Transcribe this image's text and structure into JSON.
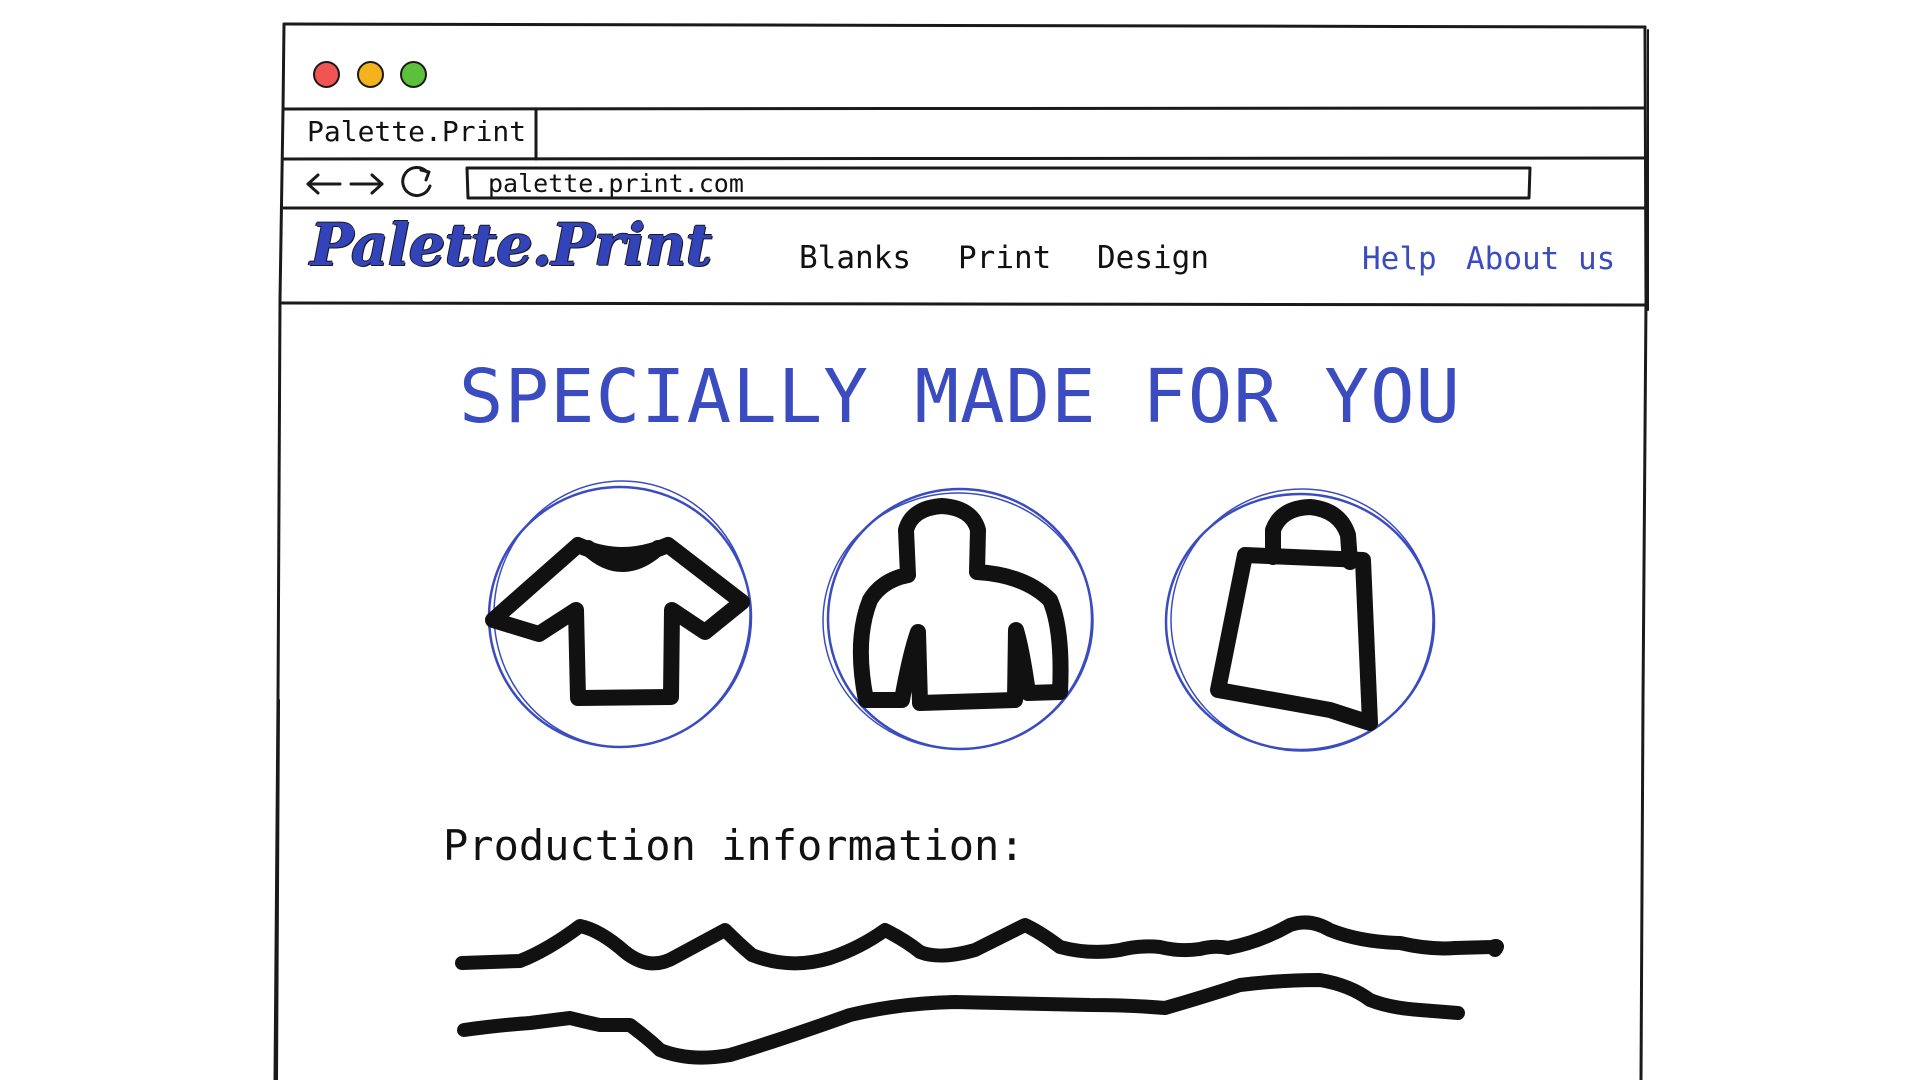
{
  "browser": {
    "tab_title": "Palette.Print",
    "url": "palette.print.com",
    "traffic_lights": {
      "close_color": "#f05454",
      "minimize_color": "#f4b31c",
      "maximize_color": "#5cc13a"
    },
    "nav_icons": [
      "back-arrow-icon",
      "forward-arrow-icon",
      "reload-icon"
    ]
  },
  "header": {
    "logo": "Palette.Print",
    "nav": [
      "Blanks",
      "Print",
      "Design"
    ],
    "links": [
      "Help",
      "About us"
    ]
  },
  "hero": {
    "title": "SPECIALLY MADE FOR YOU"
  },
  "categories": [
    {
      "icon": "tshirt-icon"
    },
    {
      "icon": "hoodie-icon"
    },
    {
      "icon": "tote-bag-icon"
    }
  ],
  "production": {
    "heading": "Production information:"
  },
  "colors": {
    "accent": "#3a4cbf",
    "ink": "#111111"
  }
}
